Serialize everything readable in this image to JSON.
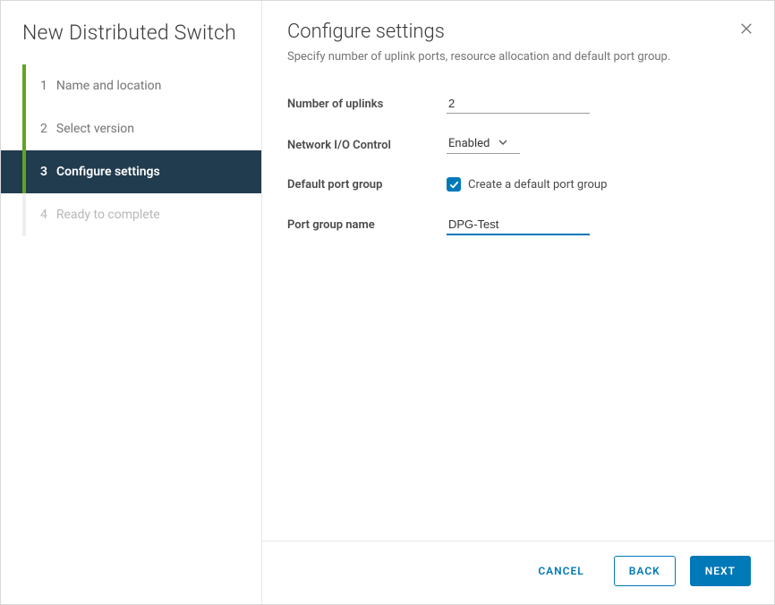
{
  "sidebar": {
    "title": "New Distributed Switch",
    "steps": [
      {
        "num": "1",
        "label": "Name and location",
        "state": "done"
      },
      {
        "num": "2",
        "label": "Select version",
        "state": "done"
      },
      {
        "num": "3",
        "label": "Configure settings",
        "state": "active"
      },
      {
        "num": "4",
        "label": "Ready to complete",
        "state": "disabled"
      }
    ]
  },
  "page": {
    "title": "Configure settings",
    "subtitle": "Specify number of uplink ports, resource allocation and default port group."
  },
  "form": {
    "uplinks_label": "Number of uplinks",
    "uplinks_value": "2",
    "nioc_label": "Network I/O Control",
    "nioc_value": "Enabled",
    "default_pg_label": "Default port group",
    "default_pg_check_label": "Create a default port group",
    "pg_name_label": "Port group name",
    "pg_name_value": "DPG-Test"
  },
  "footer": {
    "cancel": "CANCEL",
    "back": "BACK",
    "next": "NEXT"
  }
}
